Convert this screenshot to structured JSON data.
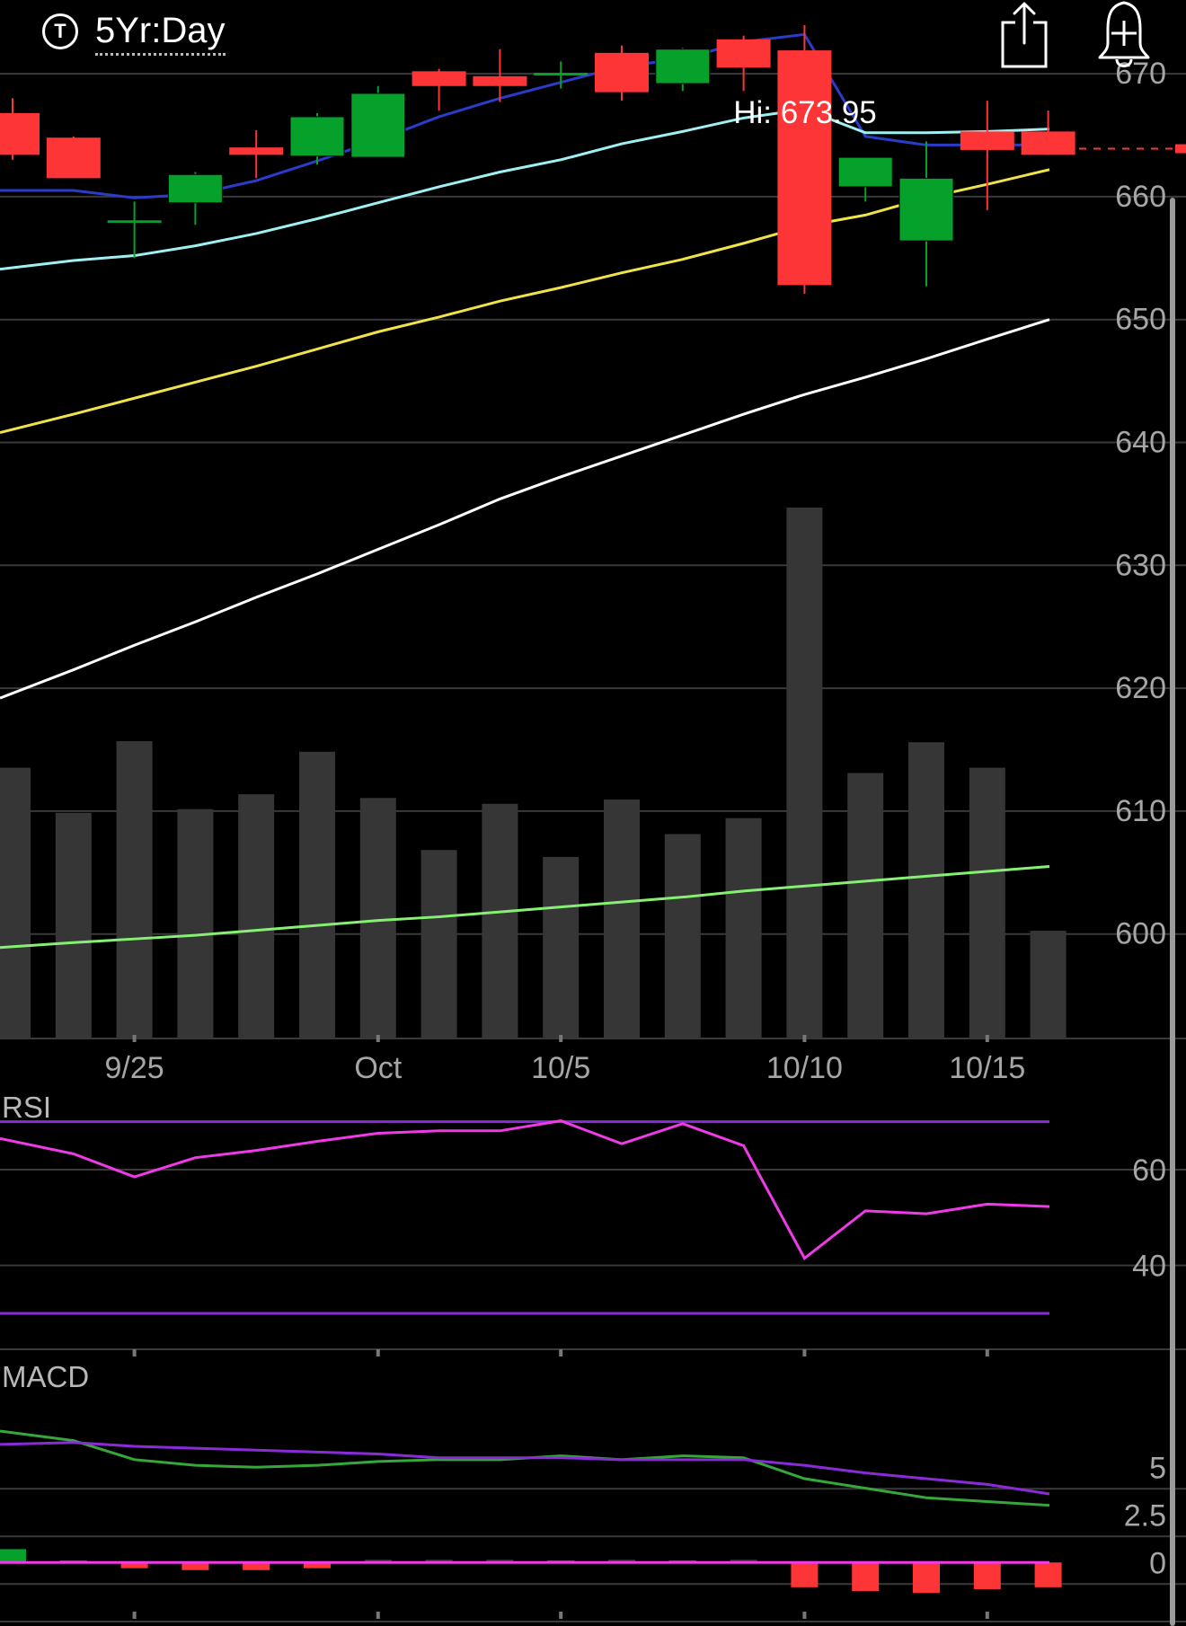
{
  "header": {
    "range_icon_text": "T",
    "range_label": "5Yr:Day",
    "share_icon": "share-icon",
    "alert_icon": "bell-plus-icon"
  },
  "chart_data": [
    {
      "type": "candlestick",
      "title": "",
      "high_label": "Hi: 673.95",
      "ylim": [
        591.5,
        676
      ],
      "y_ticks": [
        670,
        660,
        650,
        640,
        630,
        620,
        610,
        600
      ],
      "x_ticks": [
        {
          "label": "9/25",
          "index": 2
        },
        {
          "label": "Oct",
          "index": 6
        },
        {
          "label": "10/5",
          "index": 9
        },
        {
          "label": "10/10",
          "index": 13
        },
        {
          "label": "10/15",
          "index": 16
        }
      ],
      "last_price": 663.9,
      "candles": [
        {
          "o": 666.8,
          "h": 668.0,
          "l": 663.0,
          "c": 663.4
        },
        {
          "o": 664.8,
          "h": 664.9,
          "l": 661.8,
          "c": 661.5
        },
        {
          "o": 658.0,
          "h": 659.6,
          "l": 655.0,
          "c": 658.0
        },
        {
          "o": 659.5,
          "h": 662.0,
          "l": 657.7,
          "c": 661.8
        },
        {
          "o": 664.0,
          "h": 665.4,
          "l": 661.5,
          "c": 663.4
        },
        {
          "o": 663.3,
          "h": 666.8,
          "l": 662.6,
          "c": 666.5
        },
        {
          "o": 663.2,
          "h": 669.0,
          "l": 663.2,
          "c": 668.4
        },
        {
          "o": 670.2,
          "h": 670.4,
          "l": 667.0,
          "c": 669.0
        },
        {
          "o": 669.8,
          "h": 672.0,
          "l": 667.7,
          "c": 669.0
        },
        {
          "o": 670.0,
          "h": 671.0,
          "l": 668.8,
          "c": 670.0
        },
        {
          "o": 671.7,
          "h": 672.3,
          "l": 667.8,
          "c": 668.5
        },
        {
          "o": 669.2,
          "h": 672.1,
          "l": 668.6,
          "c": 672.0
        },
        {
          "o": 672.8,
          "h": 673.1,
          "l": 668.6,
          "c": 670.5
        },
        {
          "o": 671.9,
          "h": 673.95,
          "l": 652.1,
          "c": 652.8
        },
        {
          "o": 660.8,
          "h": 663.2,
          "l": 659.6,
          "c": 663.2
        },
        {
          "o": 656.4,
          "h": 664.5,
          "l": 652.7,
          "c": 661.5
        },
        {
          "o": 665.3,
          "h": 667.8,
          "l": 658.9,
          "c": 663.8
        },
        {
          "o": 665.3,
          "h": 667.0,
          "l": 663.4,
          "c": 663.4
        }
      ],
      "series": [
        {
          "color": "#2a3cc8",
          "values": [
            660.5,
            660.5,
            659.9,
            660.2,
            661.3,
            662.9,
            664.6,
            666.5,
            668.0,
            669.3,
            670.6,
            671.2,
            672.6,
            673.2,
            664.9,
            664.2,
            664.2,
            664.2
          ]
        },
        {
          "color": "#9ff0f2",
          "values": [
            654.1,
            654.8,
            655.2,
            656.0,
            657.0,
            658.2,
            659.5,
            660.8,
            662.0,
            663.0,
            664.3,
            665.3,
            666.4,
            667.1,
            665.2,
            665.2,
            665.3,
            665.5
          ]
        },
        {
          "color": "#f0e34a",
          "values": [
            640.8,
            642.3,
            643.6,
            644.9,
            646.2,
            647.6,
            649.0,
            650.2,
            651.5,
            652.6,
            653.8,
            654.9,
            656.2,
            657.6,
            658.5,
            659.9,
            661.0,
            662.2
          ]
        },
        {
          "color": "#ffffff",
          "values": [
            619.2,
            621.5,
            623.5,
            625.4,
            627.4,
            629.3,
            631.3,
            633.3,
            635.4,
            637.2,
            638.9,
            640.6,
            642.3,
            643.9,
            645.3,
            646.8,
            648.4,
            650.0
          ]
        },
        {
          "color": "#86f072",
          "values": [
            598.9,
            599.3,
            599.6,
            599.9,
            600.3,
            600.7,
            601.1,
            601.4,
            601.8,
            602.2,
            602.6,
            603.0,
            603.5,
            603.9,
            604.3,
            604.7,
            605.1,
            605.5
          ]
        }
      ],
      "volume": [
        0.51,
        0.425,
        0.56,
        0.432,
        0.46,
        0.54,
        0.453,
        0.355,
        0.442,
        0.342,
        0.45,
        0.385,
        0.415,
        1.0,
        0.5,
        0.558,
        0.51,
        0.203
      ]
    },
    {
      "type": "line",
      "title": "RSI",
      "ylim": [
        22.5,
        75
      ],
      "y_ticks": [
        60,
        40
      ],
      "bands": [
        70,
        30
      ],
      "values": [
        66.5,
        63.3,
        58.5,
        62.5,
        64.0,
        65.9,
        67.6,
        68.1,
        68.1,
        70.2,
        65.4,
        69.6,
        65.0,
        41.5,
        51.4,
        50.8,
        52.8,
        52.3
      ]
    },
    {
      "type": "line",
      "title": "MACD",
      "ylim": [
        -3.1,
        10.25
      ],
      "y_ticks": [
        5,
        2.5,
        0
      ],
      "values": [
        6.9,
        6.4,
        5.4,
        5.1,
        5.0,
        5.1,
        5.3,
        5.4,
        5.4,
        5.6,
        5.4,
        5.6,
        5.5,
        4.4,
        3.9,
        3.4,
        3.2,
        3.0
      ],
      "signal": [
        6.2,
        6.3,
        6.1,
        6.0,
        5.9,
        5.8,
        5.7,
        5.5,
        5.5,
        5.5,
        5.4,
        5.4,
        5.4,
        5.1,
        4.7,
        4.4,
        4.1,
        3.6
      ],
      "histogram": [
        0.7,
        0.1,
        -0.3,
        -0.4,
        -0.4,
        -0.3,
        0,
        0,
        0,
        0.1,
        0,
        0.1,
        0,
        -1.3,
        -1.5,
        -1.6,
        -1.4,
        -1.3
      ]
    }
  ]
}
